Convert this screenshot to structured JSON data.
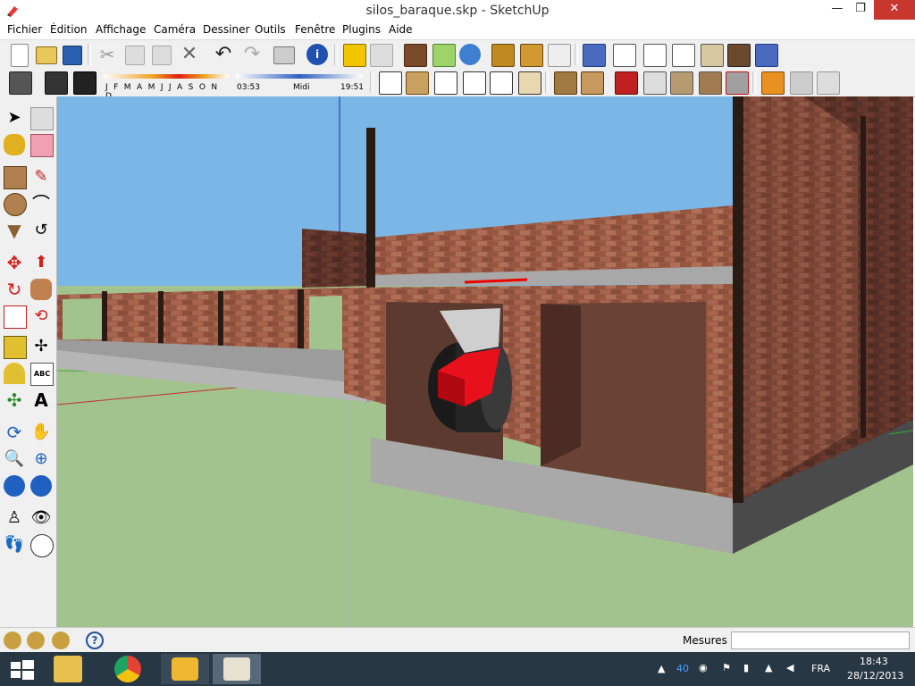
{
  "window": {
    "title": "silos_baraque.skp - SketchUp",
    "minimize": "—",
    "restore": "❐",
    "close": "✕"
  },
  "menu": [
    "Fichier",
    "Édition",
    "Affichage",
    "Caméra",
    "Dessiner",
    "Outils",
    "Fenêtre",
    "Plugins",
    "Aide"
  ],
  "shadows": {
    "months": "J F M A M J J A S O N D",
    "time_start": "03:53",
    "time_mid": "Midi",
    "time_end": "19:51"
  },
  "status": {
    "measure_label": "Mesures",
    "measure_value": ""
  },
  "taskbar": {
    "language": "FRA",
    "time": "18:43",
    "date": "28/12/2013"
  },
  "colors": {
    "sky": "#7ab6e6",
    "ground": "#a3c38e",
    "brick": "#9a5a45",
    "red_object": "#e8101a",
    "taskbar": "#283744"
  }
}
